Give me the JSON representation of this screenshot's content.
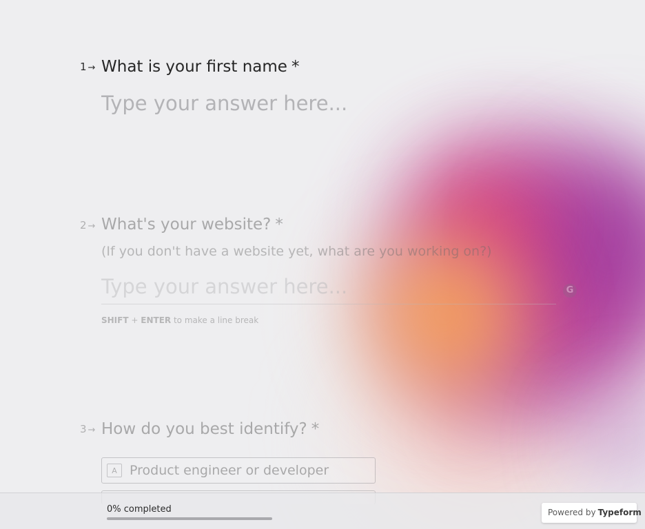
{
  "colors": {
    "background": "#eeeef0",
    "text_primary": "#262626",
    "placeholder": "#b3b3b6",
    "accent_magenta": "#cc2f8a",
    "accent_orange": "#f0904a",
    "accent_purple": "#9a3aa0"
  },
  "questions": [
    {
      "number": "1",
      "arrow": "→",
      "title": "What is your first name",
      "required_mark": "*",
      "placeholder": "Type your answer here..."
    },
    {
      "number": "2",
      "arrow": "→",
      "title": "What's your website?",
      "required_mark": "*",
      "subtitle": "(If you don't have a website yet, what are you working on?)",
      "placeholder": "Type your answer here...",
      "hint_key1": "SHIFT",
      "hint_plus": "+",
      "hint_key2": "ENTER",
      "hint_text": "to make a line break",
      "grammar_icon": "grammarly-g-icon",
      "grammar_glyph": "G"
    },
    {
      "number": "3",
      "arrow": "→",
      "title": "How do you best identify?",
      "required_mark": "*",
      "choices": [
        {
          "key": "A",
          "label": "Product engineer or developer"
        },
        {
          "key": "",
          "label": ""
        }
      ]
    }
  ],
  "footer": {
    "progress_text": "0% completed",
    "progress_value": 0,
    "powered_by": "Powered by",
    "brand": "Typeform"
  }
}
